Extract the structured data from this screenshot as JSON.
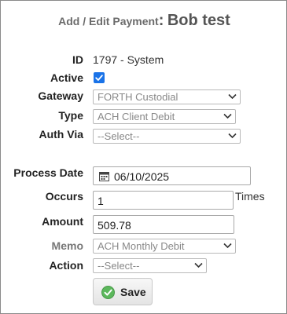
{
  "header": {
    "prefix": "Add / Edit Payment",
    "separator": ":",
    "name": "Bob test"
  },
  "labels": {
    "id": "ID",
    "active": "Active",
    "gateway": "Gateway",
    "type": "Type",
    "auth_via": "Auth Via",
    "process_date": "Process Date",
    "occurs": "Occurs",
    "amount": "Amount",
    "memo": "Memo",
    "action": "Action"
  },
  "fields": {
    "id_value": "1797 - System",
    "active_checked": true,
    "gateway_selected": "FORTH Custodial",
    "type_selected": "ACH Client Debit",
    "auth_via_selected": "--Select--",
    "process_date_value": "06/10/2025",
    "occurs_value": "1",
    "occurs_suffix": "Times",
    "amount_value": "509.78",
    "memo_selected": "ACH Monthly Debit",
    "action_selected": "--Select--"
  },
  "buttons": {
    "save_label": "Save"
  },
  "icons": {
    "checkbox": "checkmark-icon",
    "select_arrow": "chevron-down-icon",
    "date": "calendar-icon",
    "save": "check-circle-icon"
  },
  "colors": {
    "checkbox_blue": "#1a73e8",
    "save_icon_green": "#5cb85c"
  }
}
